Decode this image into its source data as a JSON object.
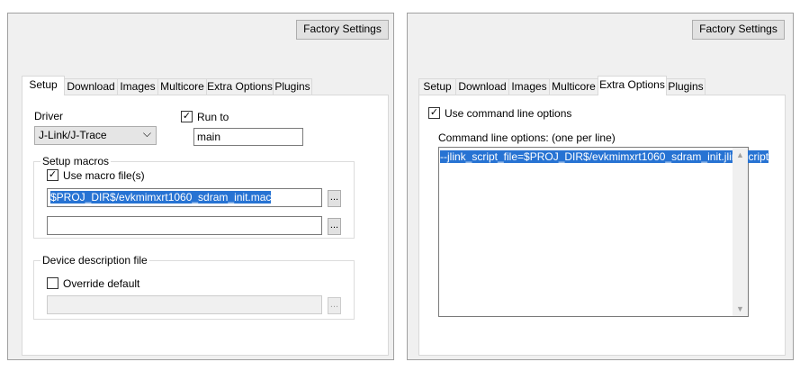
{
  "left_panel": {
    "factory_button": "Factory Settings",
    "tabs": [
      "Setup",
      "Download",
      "Images",
      "Multicore",
      "Extra Options",
      "Plugins"
    ],
    "active_tab": "Setup",
    "driver_label": "Driver",
    "driver_value": "J-Link/J-Trace",
    "run_to_label": "Run to",
    "run_to_value": "main",
    "setup_macros_title": "Setup macros",
    "use_macro_label": "Use macro file(s)",
    "macro_file_1": "$PROJ_DIR$/evkmimxrt1060_sdram_init.mac",
    "macro_file_2": "",
    "browse_label": "...",
    "device_desc_title": "Device description file",
    "override_label": "Override default",
    "device_file": ""
  },
  "right_panel": {
    "factory_button": "Factory Settings",
    "tabs": [
      "Setup",
      "Download",
      "Images",
      "Multicore",
      "Extra Options",
      "Plugins"
    ],
    "active_tab": "Extra Options",
    "use_cmd_label": "Use command line options",
    "cmd_options_label": "Command line options:  (one per line)",
    "cmd_text": "--jlink_script_file=$PROJ_DIR$/evkmimxrt1060_sdram_init.jlinkscript"
  },
  "icons": {
    "checkmark": "✓",
    "chevron_down": "⌵",
    "scroll_up": "▲",
    "scroll_down": "▼"
  }
}
